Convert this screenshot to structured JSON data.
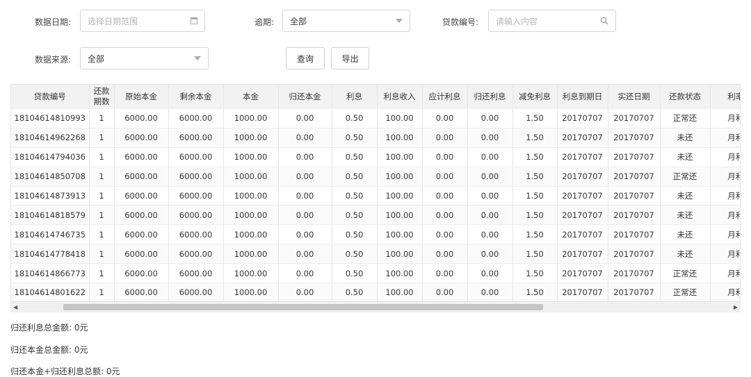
{
  "filters": {
    "date_label": "数据日期:",
    "date_placeholder": "选择日期范围",
    "period_label": "逾期:",
    "period_value": "全部",
    "loan_no_label": "贷款编号:",
    "loan_no_placeholder": "请输入内容",
    "source_label": "数据来源:",
    "source_value": "全部",
    "query_button": "查询",
    "export_button": "导出"
  },
  "table": {
    "headers": [
      "贷款编号",
      "还款期数",
      "原始本金",
      "剩余本金",
      "本金",
      "归还本金",
      "利息",
      "利息收入",
      "应计利息",
      "归还利息",
      "减免利息",
      "利息到期日",
      "实还日期",
      "还款状态",
      "利率类"
    ],
    "rows": [
      [
        "18104614810993",
        "1",
        "6000.00",
        "6000.00",
        "1000.00",
        "0.00",
        "0.50",
        "100.00",
        "0.00",
        "0.00",
        "1.50",
        "20170707",
        "20170707",
        "正常还",
        "月利率"
      ],
      [
        "18104614962268",
        "1",
        "6000.00",
        "6000.00",
        "1000.00",
        "0.00",
        "0.50",
        "100.00",
        "0.00",
        "0.00",
        "1.50",
        "20170707",
        "20170707",
        "未还",
        "月利率"
      ],
      [
        "18104614794036",
        "1",
        "6000.00",
        "6000.00",
        "1000.00",
        "0.00",
        "0.50",
        "100.00",
        "0.00",
        "0.00",
        "1.50",
        "20170707",
        "20170707",
        "未还",
        "月利率"
      ],
      [
        "18104614850708",
        "1",
        "6000.00",
        "6000.00",
        "1000.00",
        "0.00",
        "0.50",
        "100.00",
        "0.00",
        "0.00",
        "1.50",
        "20170707",
        "20170707",
        "正常还",
        "月利率"
      ],
      [
        "18104614873913",
        "1",
        "6000.00",
        "6000.00",
        "1000.00",
        "0.00",
        "0.50",
        "100.00",
        "0.00",
        "0.00",
        "1.50",
        "20170707",
        "20170707",
        "未还",
        "月利率"
      ],
      [
        "18104614818579",
        "1",
        "6000.00",
        "6000.00",
        "1000.00",
        "0.00",
        "0.50",
        "100.00",
        "0.00",
        "0.00",
        "1.50",
        "20170707",
        "20170707",
        "未还",
        "月利率"
      ],
      [
        "18104614746735",
        "1",
        "6000.00",
        "6000.00",
        "1000.00",
        "0.00",
        "0.50",
        "100.00",
        "0.00",
        "0.00",
        "1.50",
        "20170707",
        "20170707",
        "未还",
        "月利率"
      ],
      [
        "18104614778418",
        "1",
        "6000.00",
        "6000.00",
        "1000.00",
        "0.00",
        "0.50",
        "100.00",
        "0.00",
        "0.00",
        "1.50",
        "20170707",
        "20170707",
        "未还",
        "月利率"
      ],
      [
        "18104614866773",
        "1",
        "6000.00",
        "6000.00",
        "1000.00",
        "0.00",
        "0.50",
        "100.00",
        "0.00",
        "0.00",
        "1.50",
        "20170707",
        "20170707",
        "正常还",
        "月利率"
      ],
      [
        "18104614801622",
        "1",
        "6000.00",
        "6000.00",
        "1000.00",
        "0.00",
        "0.50",
        "100.00",
        "0.00",
        "0.00",
        "1.50",
        "20170707",
        "20170707",
        "正常还",
        "月利率"
      ]
    ]
  },
  "summary": {
    "interest_total": "归还利息总金额: 0元",
    "principal_total": "归还本金总金额: 0元",
    "combined_total": "归还本金+归还利息总额: 0元"
  }
}
